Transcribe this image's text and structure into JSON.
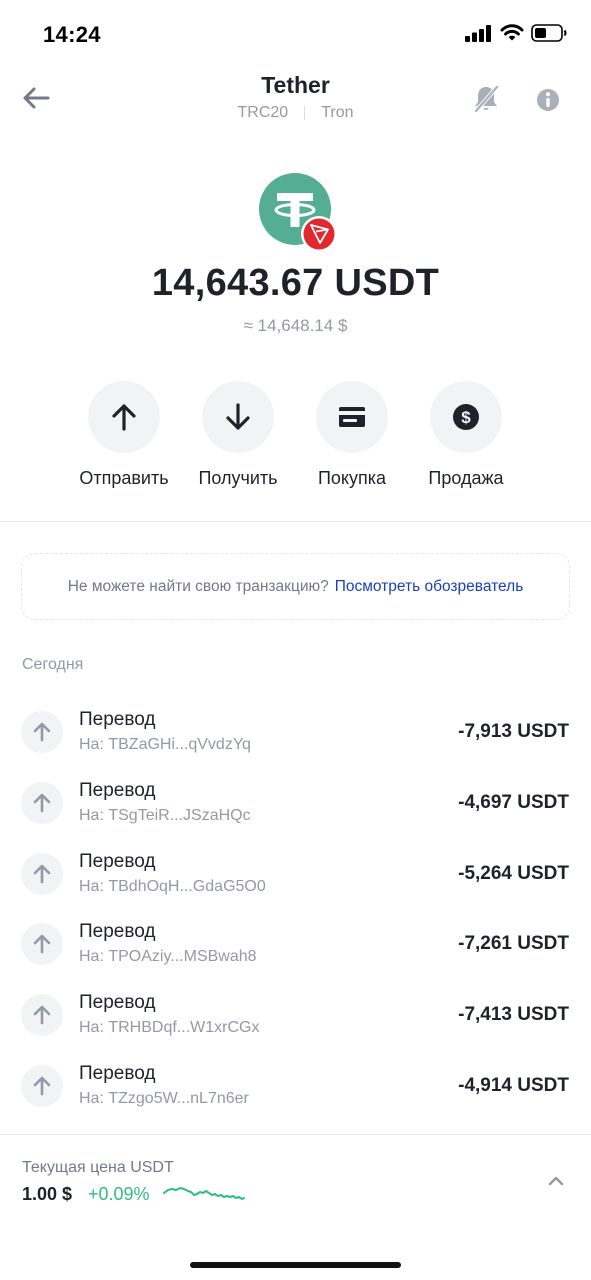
{
  "status_bar": {
    "time": "14:24"
  },
  "header": {
    "title": "Tether",
    "network": "TRC20",
    "chain": "Tron"
  },
  "icons": {
    "back": "arrow-left-icon",
    "mute": "bell-off-icon",
    "info": "info-icon",
    "token": "tether-logo",
    "chain_badge": "tron-badge-icon"
  },
  "balance": {
    "amount": "14,643.67 USDT",
    "fiat": "≈ 14,648.14 $"
  },
  "actions": [
    {
      "label": "Отправить",
      "icon": "arrow-up-icon"
    },
    {
      "label": "Получить",
      "icon": "arrow-down-icon"
    },
    {
      "label": "Покупка",
      "icon": "card-icon"
    },
    {
      "label": "Продажа",
      "icon": "dollar-coin-icon"
    }
  ],
  "explorer": {
    "text": "Не можете найти свою транзакцию?",
    "link": "Посмотреть обозреватель"
  },
  "history": {
    "section_label": "Сегодня",
    "transactions": [
      {
        "title": "Перевод",
        "address": "На: TBZaGHi...qVvdzYq",
        "amount": "-7,913 USDT"
      },
      {
        "title": "Перевод",
        "address": "На: TSgTeiR...JSzaHQc",
        "amount": "-4,697 USDT"
      },
      {
        "title": "Перевод",
        "address": "На: TBdhOqH...GdaG5O0",
        "amount": "-5,264 USDT"
      },
      {
        "title": "Перевод",
        "address": "На: TPOAziy...MSBwah8",
        "amount": "-7,261 USDT"
      },
      {
        "title": "Перевод",
        "address": "На: TRHBDqf...W1xrCGx",
        "amount": "-7,413 USDT"
      },
      {
        "title": "Перевод",
        "address": "На: TZzgo5W...nL7n6er",
        "amount": "-4,914 USDT"
      }
    ]
  },
  "price_panel": {
    "label": "Текущая цена USDT",
    "price": "1.00 $",
    "change": "+0.09%",
    "change_color": "#2ebd85"
  },
  "colors": {
    "token_green": "#53ae94",
    "tron_red": "#e0282e",
    "link_blue": "#1a3fb8",
    "text_primary": "#1e2329",
    "text_secondary": "#929aa5"
  }
}
